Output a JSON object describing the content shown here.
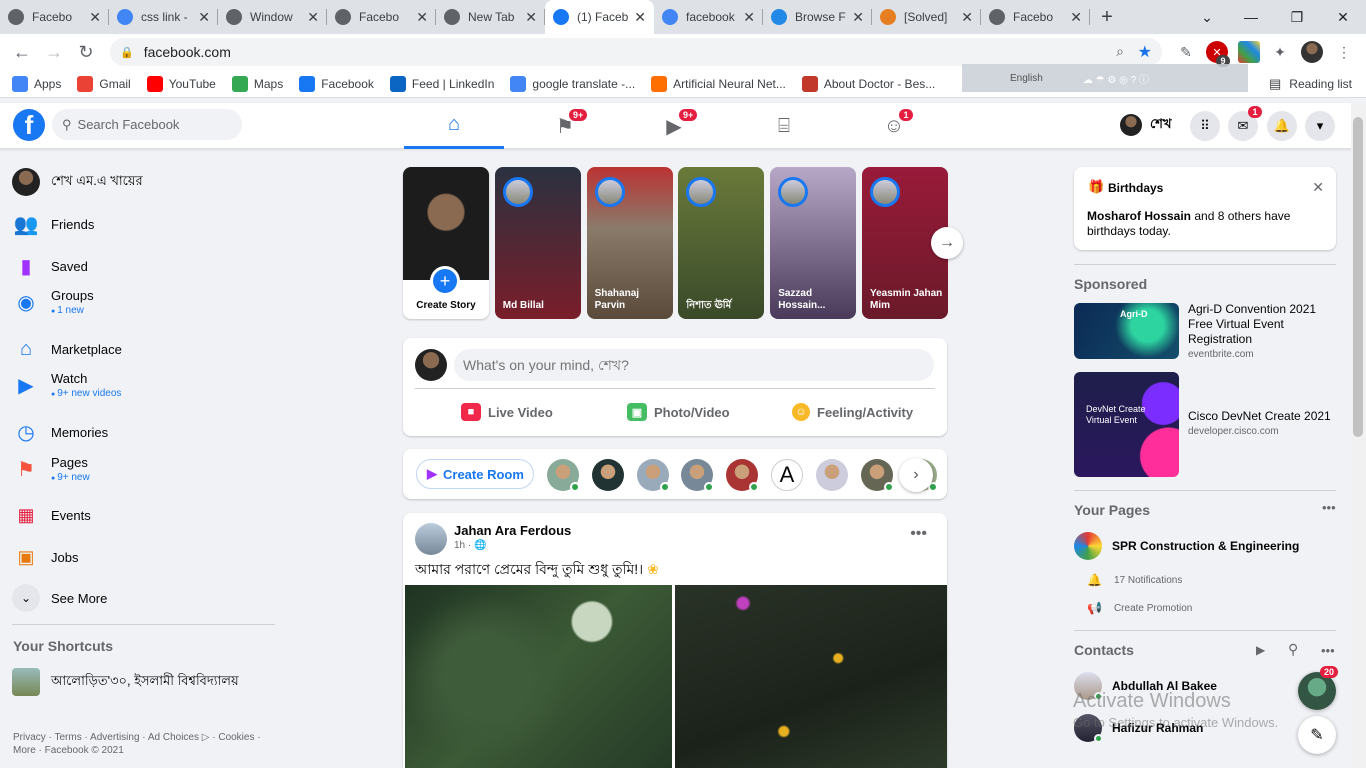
{
  "browser": {
    "tabs": [
      {
        "title": "Facebo",
        "icon": "globe-icon",
        "color": "#5f6368"
      },
      {
        "title": "css link -",
        "icon": "google-icon",
        "color": "#4285f4"
      },
      {
        "title": "Window",
        "icon": "globe-icon",
        "color": "#5f6368"
      },
      {
        "title": "Facebo",
        "icon": "globe-icon",
        "color": "#5f6368"
      },
      {
        "title": "New Tab",
        "icon": "chrome-icon",
        "color": "#5f6368"
      },
      {
        "title": "(1) Faceb",
        "icon": "facebook-icon",
        "color": "#1877f2"
      },
      {
        "title": "facebook",
        "icon": "google-icon",
        "color": "#4285f4"
      },
      {
        "title": "Browse F",
        "icon": "fontawesome-icon",
        "color": "#228ae6"
      },
      {
        "title": "[Solved]",
        "icon": "solved-icon",
        "color": "#e67e22"
      },
      {
        "title": "Facebo",
        "icon": "globe-icon",
        "color": "#5f6368"
      }
    ],
    "url": "facebook.com",
    "bookmarks": [
      {
        "label": "Apps",
        "icon": "apps-grid-icon",
        "color": "#4285f4"
      },
      {
        "label": "Gmail",
        "icon": "gmail-icon",
        "color": "#ea4335"
      },
      {
        "label": "YouTube",
        "icon": "youtube-icon",
        "color": "#ff0000"
      },
      {
        "label": "Maps",
        "icon": "maps-pin-icon",
        "color": "#34a853"
      },
      {
        "label": "Facebook",
        "icon": "facebook-icon",
        "color": "#1877f2"
      },
      {
        "label": "Feed | LinkedIn",
        "icon": "linkedin-icon",
        "color": "#0a66c2"
      },
      {
        "label": "google translate -...",
        "icon": "google-icon",
        "color": "#4285f4"
      },
      {
        "label": "Artificial Neural Net...",
        "icon": "tf-icon",
        "color": "#ff6f00"
      },
      {
        "label": "About Doctor - Bes...",
        "icon": "doctor-icon",
        "color": "#c0392b"
      }
    ],
    "language": "English",
    "reading_list": "Reading list",
    "extension_badge": "9"
  },
  "fb": {
    "search_placeholder": "Search Facebook",
    "nav_badges": {
      "pages": "9+",
      "watch": "9+",
      "groups": "1"
    },
    "me_name": "শেখ",
    "messenger_badge": "1",
    "sidebar": [
      {
        "label": "শেখ এম.এ খায়ের",
        "icon": "profile-avatar",
        "sub": ""
      },
      {
        "label": "Friends",
        "icon": "friends-icon",
        "sub": ""
      },
      {
        "label": "Saved",
        "icon": "saved-icon",
        "sub": ""
      },
      {
        "label": "Groups",
        "icon": "groups-icon",
        "sub": "1 new"
      },
      {
        "label": "Marketplace",
        "icon": "marketplace-icon",
        "sub": ""
      },
      {
        "label": "Watch",
        "icon": "watch-icon",
        "sub": "9+ new videos"
      },
      {
        "label": "Memories",
        "icon": "memories-icon",
        "sub": ""
      },
      {
        "label": "Pages",
        "icon": "pages-icon",
        "sub": "9+ new"
      },
      {
        "label": "Events",
        "icon": "events-icon",
        "sub": ""
      },
      {
        "label": "Jobs",
        "icon": "jobs-icon",
        "sub": ""
      },
      {
        "label": "See More",
        "icon": "chevron-down-icon",
        "sub": ""
      }
    ],
    "shortcuts_title": "Your Shortcuts",
    "shortcut": "আলোড়িত'৩০, ইসলামী বিশ্ববিদ্যালয়",
    "footer1": "Privacy · Terms · Advertising · Ad Choices ▷ · Cookies ·",
    "footer2": "More · Facebook © 2021",
    "stories": [
      {
        "name": "Create Story"
      },
      {
        "name": "Md Billal"
      },
      {
        "name": "Shahanaj Parvin"
      },
      {
        "name": "নিশাত ঊর্মি"
      },
      {
        "name": "Sazzad Hossain..."
      },
      {
        "name": "Yeasmin Jahan Mim"
      }
    ],
    "composer_placeholder": "What's on your mind, শেখ?",
    "actions": [
      "Live Video",
      "Photo/Video",
      "Feeling/Activity"
    ],
    "create_room": "Create Room",
    "post": {
      "author": "Jahan Ara Ferdous",
      "time": "1h",
      "text": "আমার পরাণে প্রেমের বিন্দু তুমি শুধু তুমি!।"
    },
    "birthdays": {
      "title": "Birthdays",
      "text_strong": "Mosharof Hossain",
      "text_rest": " and 8 others have birthdays today."
    },
    "sponsored_title": "Sponsored",
    "ads": [
      {
        "title": "Agri-D Convention 2021 Free Virtual Event Registration",
        "url": "eventbrite.com",
        "img_text": "Agri-D"
      },
      {
        "title": "Cisco DevNet Create 2021",
        "url": "developer.cisco.com",
        "img_text": "DevNet Create Virtual Event"
      }
    ],
    "your_pages_title": "Your Pages",
    "page_name": "SPR Construction & Engineering",
    "notifications": "17 Notifications",
    "create_promotion": "Create Promotion",
    "contacts_title": "Contacts",
    "contacts": [
      "Abdullah Al Bakee",
      "Hafizur Rahman"
    ],
    "chat_badge": "20",
    "activate1": "Activate Windows",
    "activate2": "Go to Settings to activate Windows."
  }
}
